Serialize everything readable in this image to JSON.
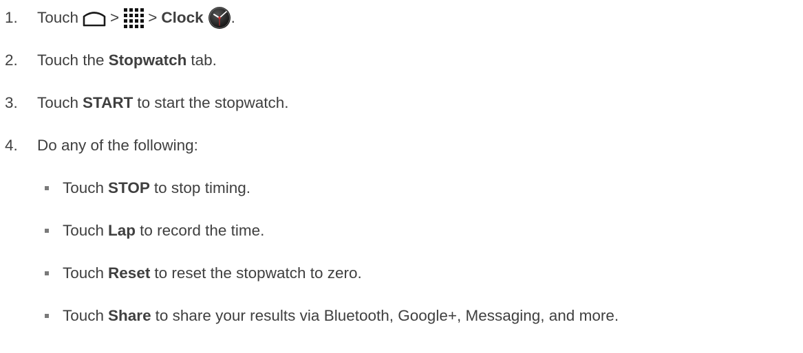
{
  "steps": [
    {
      "number": "1.",
      "touch": "Touch",
      "gt1": ">",
      "gt2": ">",
      "clock_label": "Clock",
      "period": ".",
      "icons": [
        "home-icon",
        "apps-grid-icon",
        "clock-app-icon"
      ]
    },
    {
      "number": "2.",
      "text_before": "Touch the",
      "bold": "Stopwatch",
      "text_after": "tab."
    },
    {
      "number": "3.",
      "text_before": "Touch",
      "bold": "START",
      "text_after": "to start the stopwatch."
    },
    {
      "number": "4.",
      "text": "Do any of the following:"
    }
  ],
  "substeps": [
    {
      "text_before": "Touch",
      "bold": "STOP",
      "text_after": "to stop timing."
    },
    {
      "text_before": "Touch",
      "bold": "Lap",
      "text_after": "to record the time."
    },
    {
      "text_before": "Touch",
      "bold": "Reset",
      "text_after": "to reset the stopwatch to zero."
    },
    {
      "text_before": "Touch",
      "bold": "Share",
      "text_after": "to share your results via Bluetooth, Google+, Messaging, and more."
    }
  ],
  "colors": {
    "text": "#3f3f3f",
    "bullet": "#7a7a7a"
  }
}
